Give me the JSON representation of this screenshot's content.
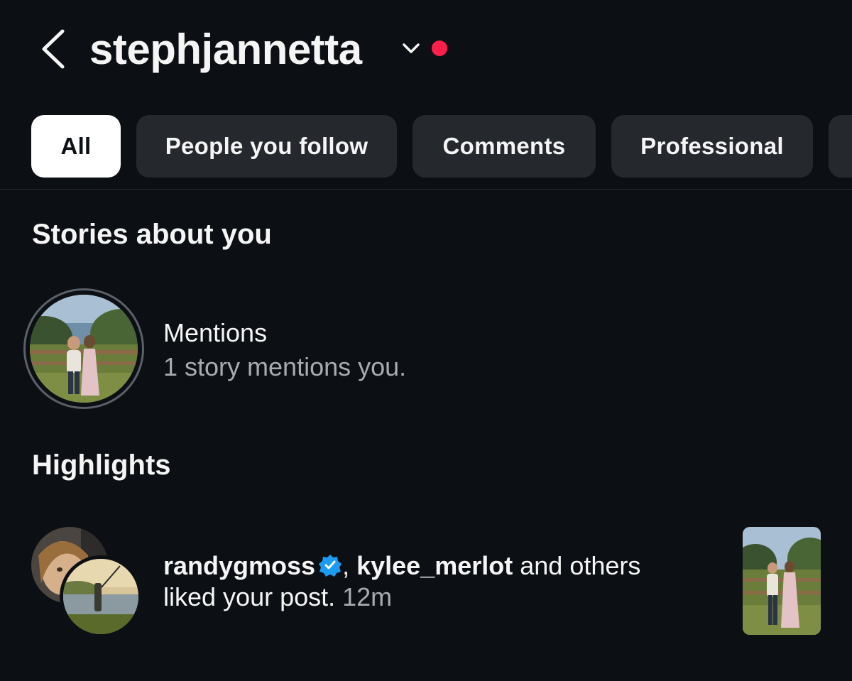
{
  "header": {
    "title": "stephjannetta",
    "has_unread_dot": true
  },
  "filters": [
    {
      "label": "All",
      "active": true
    },
    {
      "label": "People you follow",
      "active": false
    },
    {
      "label": "Comments",
      "active": false
    },
    {
      "label": "Professional",
      "active": false
    }
  ],
  "sections": {
    "stories_title": "Stories about you",
    "highlights_title": "Highlights"
  },
  "mentions": {
    "title": "Mentions",
    "subtitle": "1 story mentions you."
  },
  "notification": {
    "user1": "randygmoss",
    "separator": ",",
    "user2": "kylee_merlot",
    "and_others": "and others",
    "action": "liked your post.",
    "time": "12m"
  },
  "colors": {
    "background": "#0c1014",
    "pill": "#25292e",
    "unread_dot": "#ff1f4a",
    "verified": "#1d9bf0",
    "muted_text": "#a8abb0"
  }
}
